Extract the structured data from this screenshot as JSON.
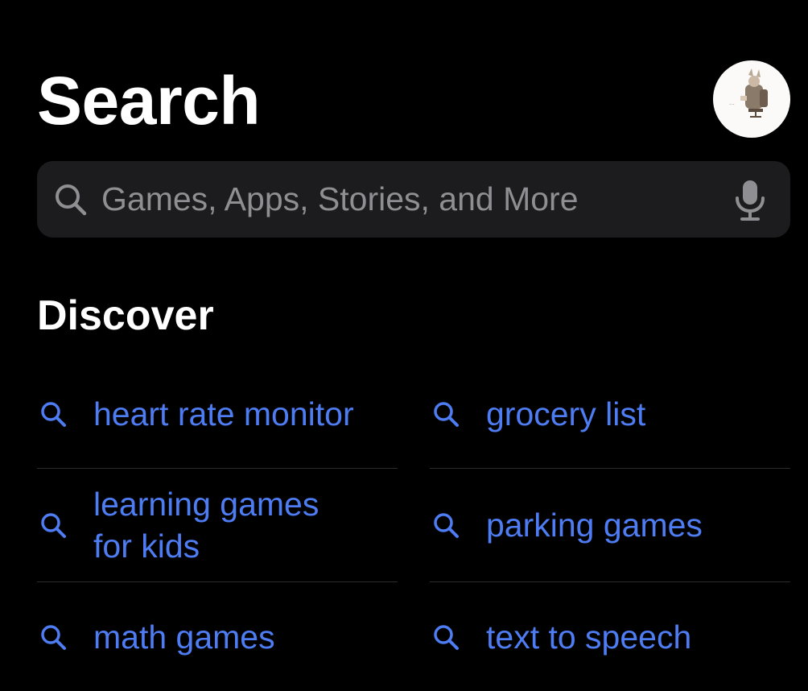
{
  "header": {
    "title": "Search",
    "avatar_icon": "profile-avatar-icon"
  },
  "search": {
    "placeholder": "Games, Apps, Stories, and More",
    "value": "",
    "search_icon": "search-icon",
    "mic_icon": "microphone-icon"
  },
  "discover": {
    "title": "Discover",
    "items": [
      {
        "label": "heart rate monitor"
      },
      {
        "label": "grocery list"
      },
      {
        "label": "learning games for kids"
      },
      {
        "label": "parking games"
      },
      {
        "label": "math games"
      },
      {
        "label": "text to speech"
      }
    ]
  },
  "colors": {
    "background": "#000000",
    "search_bar": "#1c1c1e",
    "placeholder": "#8e8e93",
    "link_blue": "#4e7cf2",
    "divider": "#2c2c2e"
  }
}
